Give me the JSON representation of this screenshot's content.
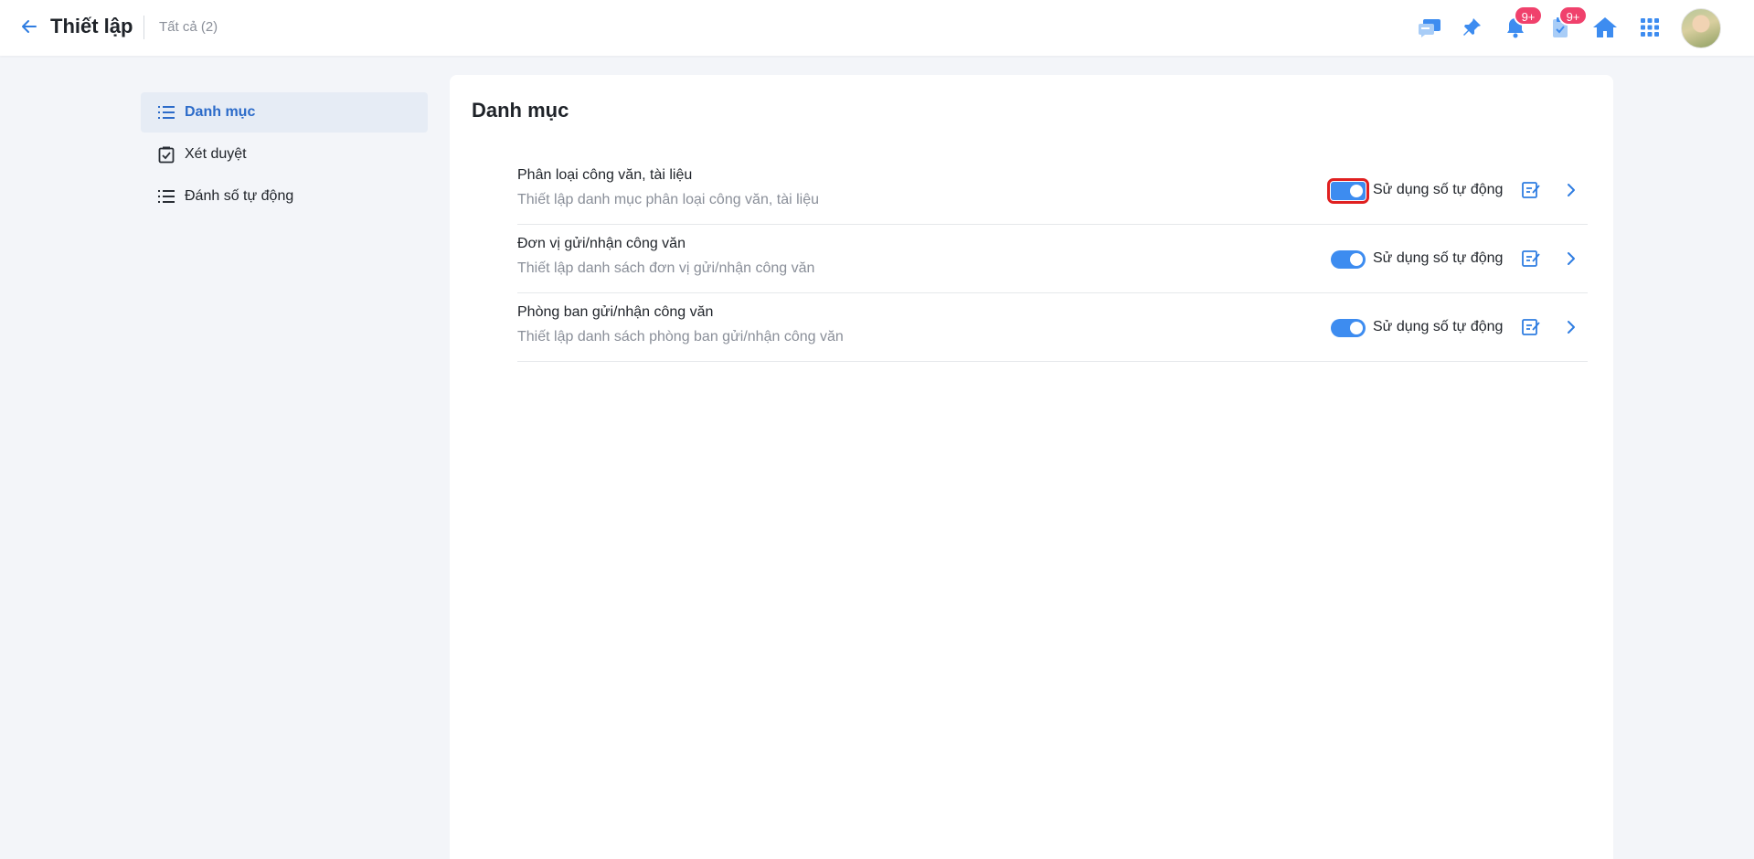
{
  "header": {
    "title": "Thiết lập",
    "subtitle": "Tất cả (2)",
    "icons": [
      {
        "name": "chat-icon"
      },
      {
        "name": "pin-icon"
      },
      {
        "name": "bell-icon",
        "badge": "9+"
      },
      {
        "name": "clipboard-icon",
        "badge": "9+"
      },
      {
        "name": "home-icon"
      },
      {
        "name": "apps-grid-icon"
      }
    ]
  },
  "sidebar": {
    "items": [
      {
        "label": "Danh mục",
        "icon": "list-icon",
        "active": true
      },
      {
        "label": "Xét duyệt",
        "icon": "checkbox-icon",
        "active": false
      },
      {
        "label": "Đánh số tự động",
        "icon": "list-icon",
        "active": false
      }
    ]
  },
  "main": {
    "title": "Danh mục",
    "rows": [
      {
        "title": "Phân loại công văn, tài liệu",
        "description": "Thiết lập danh mục phân loại công văn, tài liệu",
        "toggle_label": "Sử dụng số tự động",
        "toggle_on": true
      },
      {
        "title": "Đơn vị gửi/nhận công văn",
        "description": "Thiết lập danh sách đơn vị gửi/nhận công văn",
        "toggle_label": "Sử dụng số tự động",
        "toggle_on": true
      },
      {
        "title": "Phòng ban gửi/nhận công văn",
        "description": "Thiết lập danh sách phòng ban gửi/nhận công văn",
        "toggle_label": "Sử dụng số tự động",
        "toggle_on": true
      }
    ]
  },
  "colors": {
    "accent": "#3d8cf0",
    "badge": "#f0416c",
    "active_bg": "#e6ecf5"
  }
}
